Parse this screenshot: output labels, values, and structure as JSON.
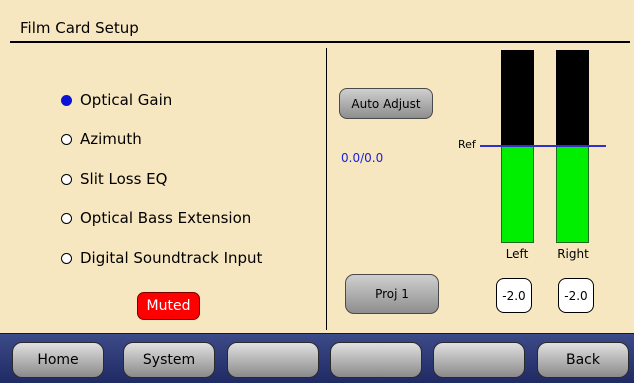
{
  "title": "Film Card Setup",
  "options": [
    {
      "label": "Optical Gain",
      "selected": true
    },
    {
      "label": "Azimuth",
      "selected": false
    },
    {
      "label": "Slit Loss EQ",
      "selected": false
    },
    {
      "label": "Optical Bass Extension",
      "selected": false
    },
    {
      "label": "Digital Soundtrack Input",
      "selected": false
    }
  ],
  "muted_label": "Muted",
  "auto_adjust_label": "Auto Adjust",
  "ratio_value": "0.0/0.0",
  "projector_label": "Proj 1",
  "meters": {
    "ref_label": "Ref",
    "left": {
      "label": "Left",
      "value": "-2.0",
      "level_fraction": 0.51
    },
    "right": {
      "label": "Right",
      "value": "-2.0",
      "level_fraction": 0.51
    }
  },
  "nav": [
    "Home",
    "System",
    "",
    "",
    "",
    "Back"
  ],
  "colors": {
    "background": "#f7e7c0",
    "selected_radio": "#0a12d6",
    "muted": "#ff0000",
    "meter_level": "#00ee00",
    "ratio_text": "#1a22d6",
    "navbar": "#2a3572"
  }
}
